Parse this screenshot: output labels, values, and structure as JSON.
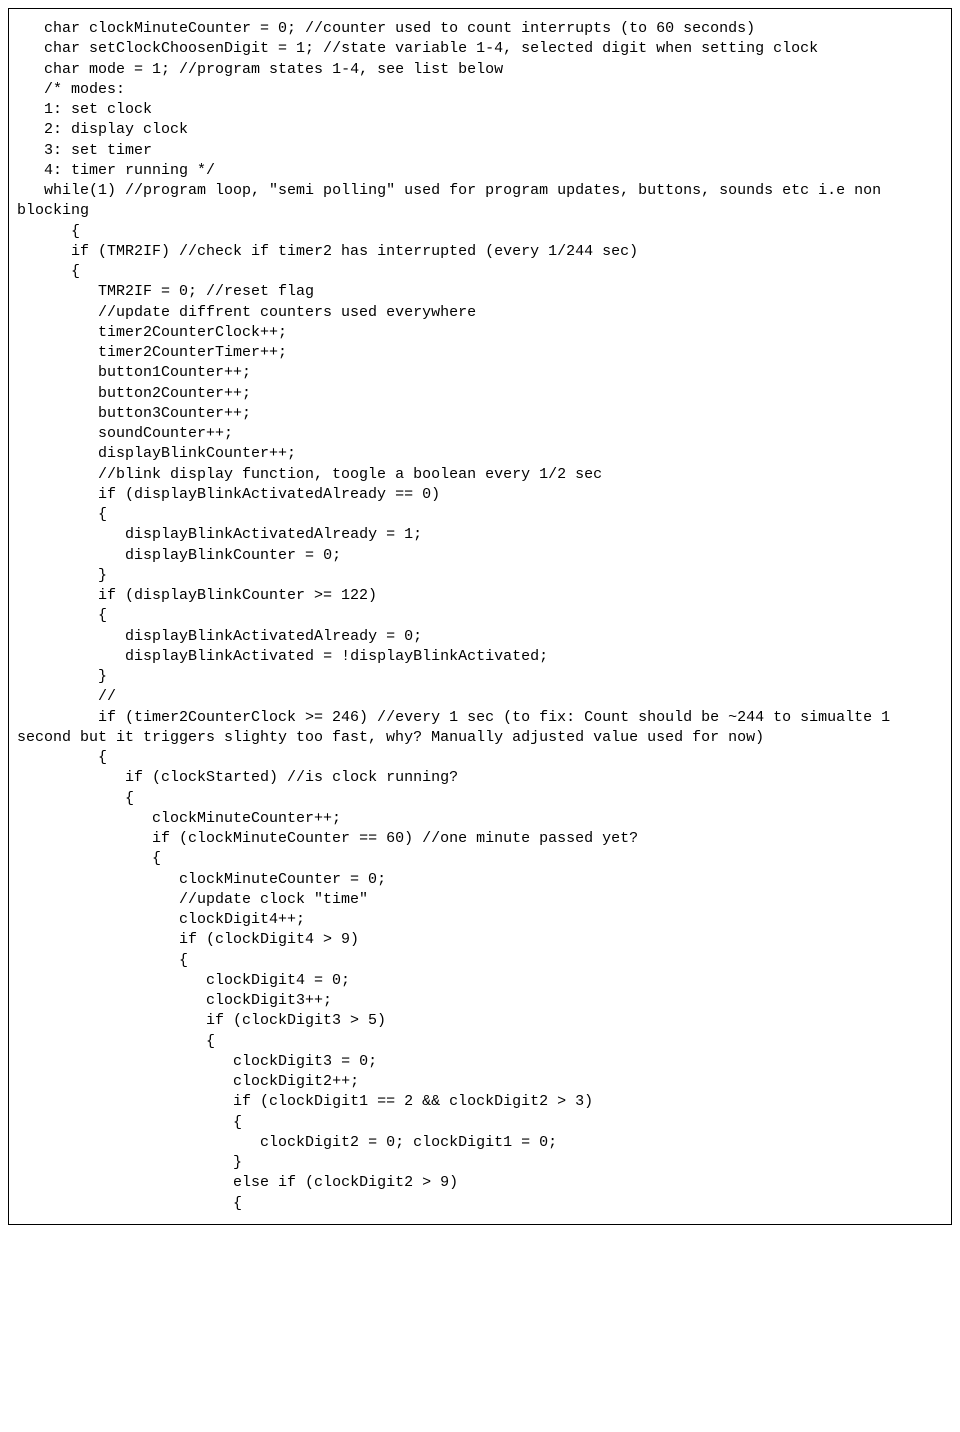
{
  "code_lines": [
    "   char clockMinuteCounter = 0; //counter used to count interrupts (to 60 seconds)",
    "",
    "   char setClockChoosenDigit = 1; //state variable 1-4, selected digit when setting clock",
    "",
    "   char mode = 1; //program states 1-4, see list below",
    "   /* modes:",
    "   1: set clock",
    "   2: display clock",
    "   3: set timer",
    "   4: timer running */",
    "",
    "   while(1) //program loop, \"semi polling\" used for program updates, buttons, sounds etc i.e non blocking",
    "      {",
    "      if (TMR2IF) //check if timer2 has interrupted (every 1/244 sec)",
    "      {",
    "         TMR2IF = 0; //reset flag",
    "",
    "         //update diffrent counters used everywhere",
    "         timer2CounterClock++;",
    "         timer2CounterTimer++;",
    "         button1Counter++;",
    "         button2Counter++;",
    "         button3Counter++;",
    "         soundCounter++;",
    "         displayBlinkCounter++;",
    "",
    "         //blink display function, toogle a boolean every 1/2 sec",
    "         if (displayBlinkActivatedAlready == 0)",
    "         {",
    "            displayBlinkActivatedAlready = 1;",
    "            displayBlinkCounter = 0;",
    "         }",
    "         if (displayBlinkCounter >= 122)",
    "         {",
    "            displayBlinkActivatedAlready = 0;",
    "            displayBlinkActivated = !displayBlinkActivated;",
    "         }",
    "",
    "         //",
    "         if (timer2CounterClock >= 246) //every 1 sec (to fix: Count should be ~244 to simualte 1 second but it triggers slighty too fast, why? Manually adjusted value used for now)",
    "         {",
    "            if (clockStarted) //is clock running?",
    "            {",
    "               clockMinuteCounter++;",
    "               if (clockMinuteCounter == 60) //one minute passed yet?",
    "               {",
    "                  clockMinuteCounter = 0;",
    "",
    "                  //update clock \"time\"",
    "                  clockDigit4++;",
    "                  if (clockDigit4 > 9)",
    "                  {",
    "                     clockDigit4 = 0;",
    "                     clockDigit3++;",
    "                     if (clockDigit3 > 5)",
    "                     {",
    "                        clockDigit3 = 0;",
    "                        clockDigit2++;",
    "                        if (clockDigit1 == 2 && clockDigit2 > 3)",
    "                        {",
    "                           clockDigit2 = 0; clockDigit1 = 0;",
    "                        }",
    "                        else if (clockDigit2 > 9)",
    "                        {"
  ]
}
